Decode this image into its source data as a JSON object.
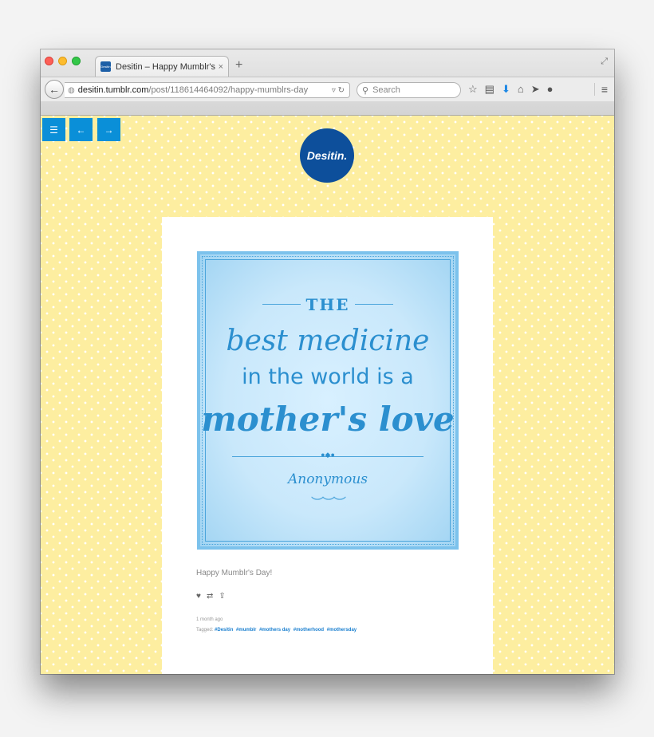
{
  "browser": {
    "tab_title": "Desitin – Happy Mumblr's…",
    "tab_favicon_text": "Desitin",
    "tab_close": "×",
    "new_tab": "+",
    "url_host": "desitin.tumblr.com",
    "url_path": "/post/118614464092/happy-mumblrs-day",
    "search_placeholder": "Search"
  },
  "page": {
    "logo_text": "Desitin.",
    "nav_buttons": {
      "menu": "☰",
      "prev": "←",
      "next": "→"
    },
    "poster": {
      "line_the": "THE",
      "line_best": "best medicine",
      "line_world": "in the world is a",
      "line_love": "mother's love",
      "attribution": "Anonymous"
    },
    "caption": "Happy Mumblr's Day!",
    "time": "1 month ago",
    "tagged_label": "Tagged:",
    "tags": [
      "#Desitin",
      "#mumblr",
      "#mothers day",
      "#motherhood",
      "#mothersday"
    ]
  },
  "colors": {
    "page_bg": "#fdeea0",
    "accent_blue": "#0a8fd8",
    "logo_blue": "#0d4f9b",
    "poster_blue": "#2b8fcf"
  }
}
